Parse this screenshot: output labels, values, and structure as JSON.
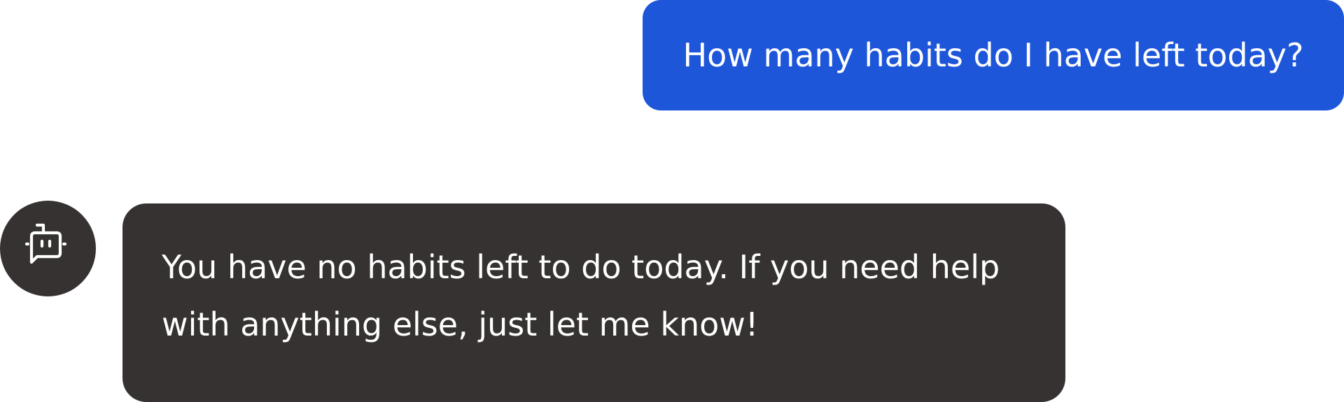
{
  "conversation": {
    "user_message": "How many habits do I have left today?",
    "bot_message": "You have no habits left to do today. If you need help with anything else, just let me know!",
    "bot_avatar_icon": "robot-chat-icon"
  },
  "colors": {
    "user_bubble": "#1e56d9",
    "bot_bubble": "#363231",
    "text": "#ffffff"
  }
}
